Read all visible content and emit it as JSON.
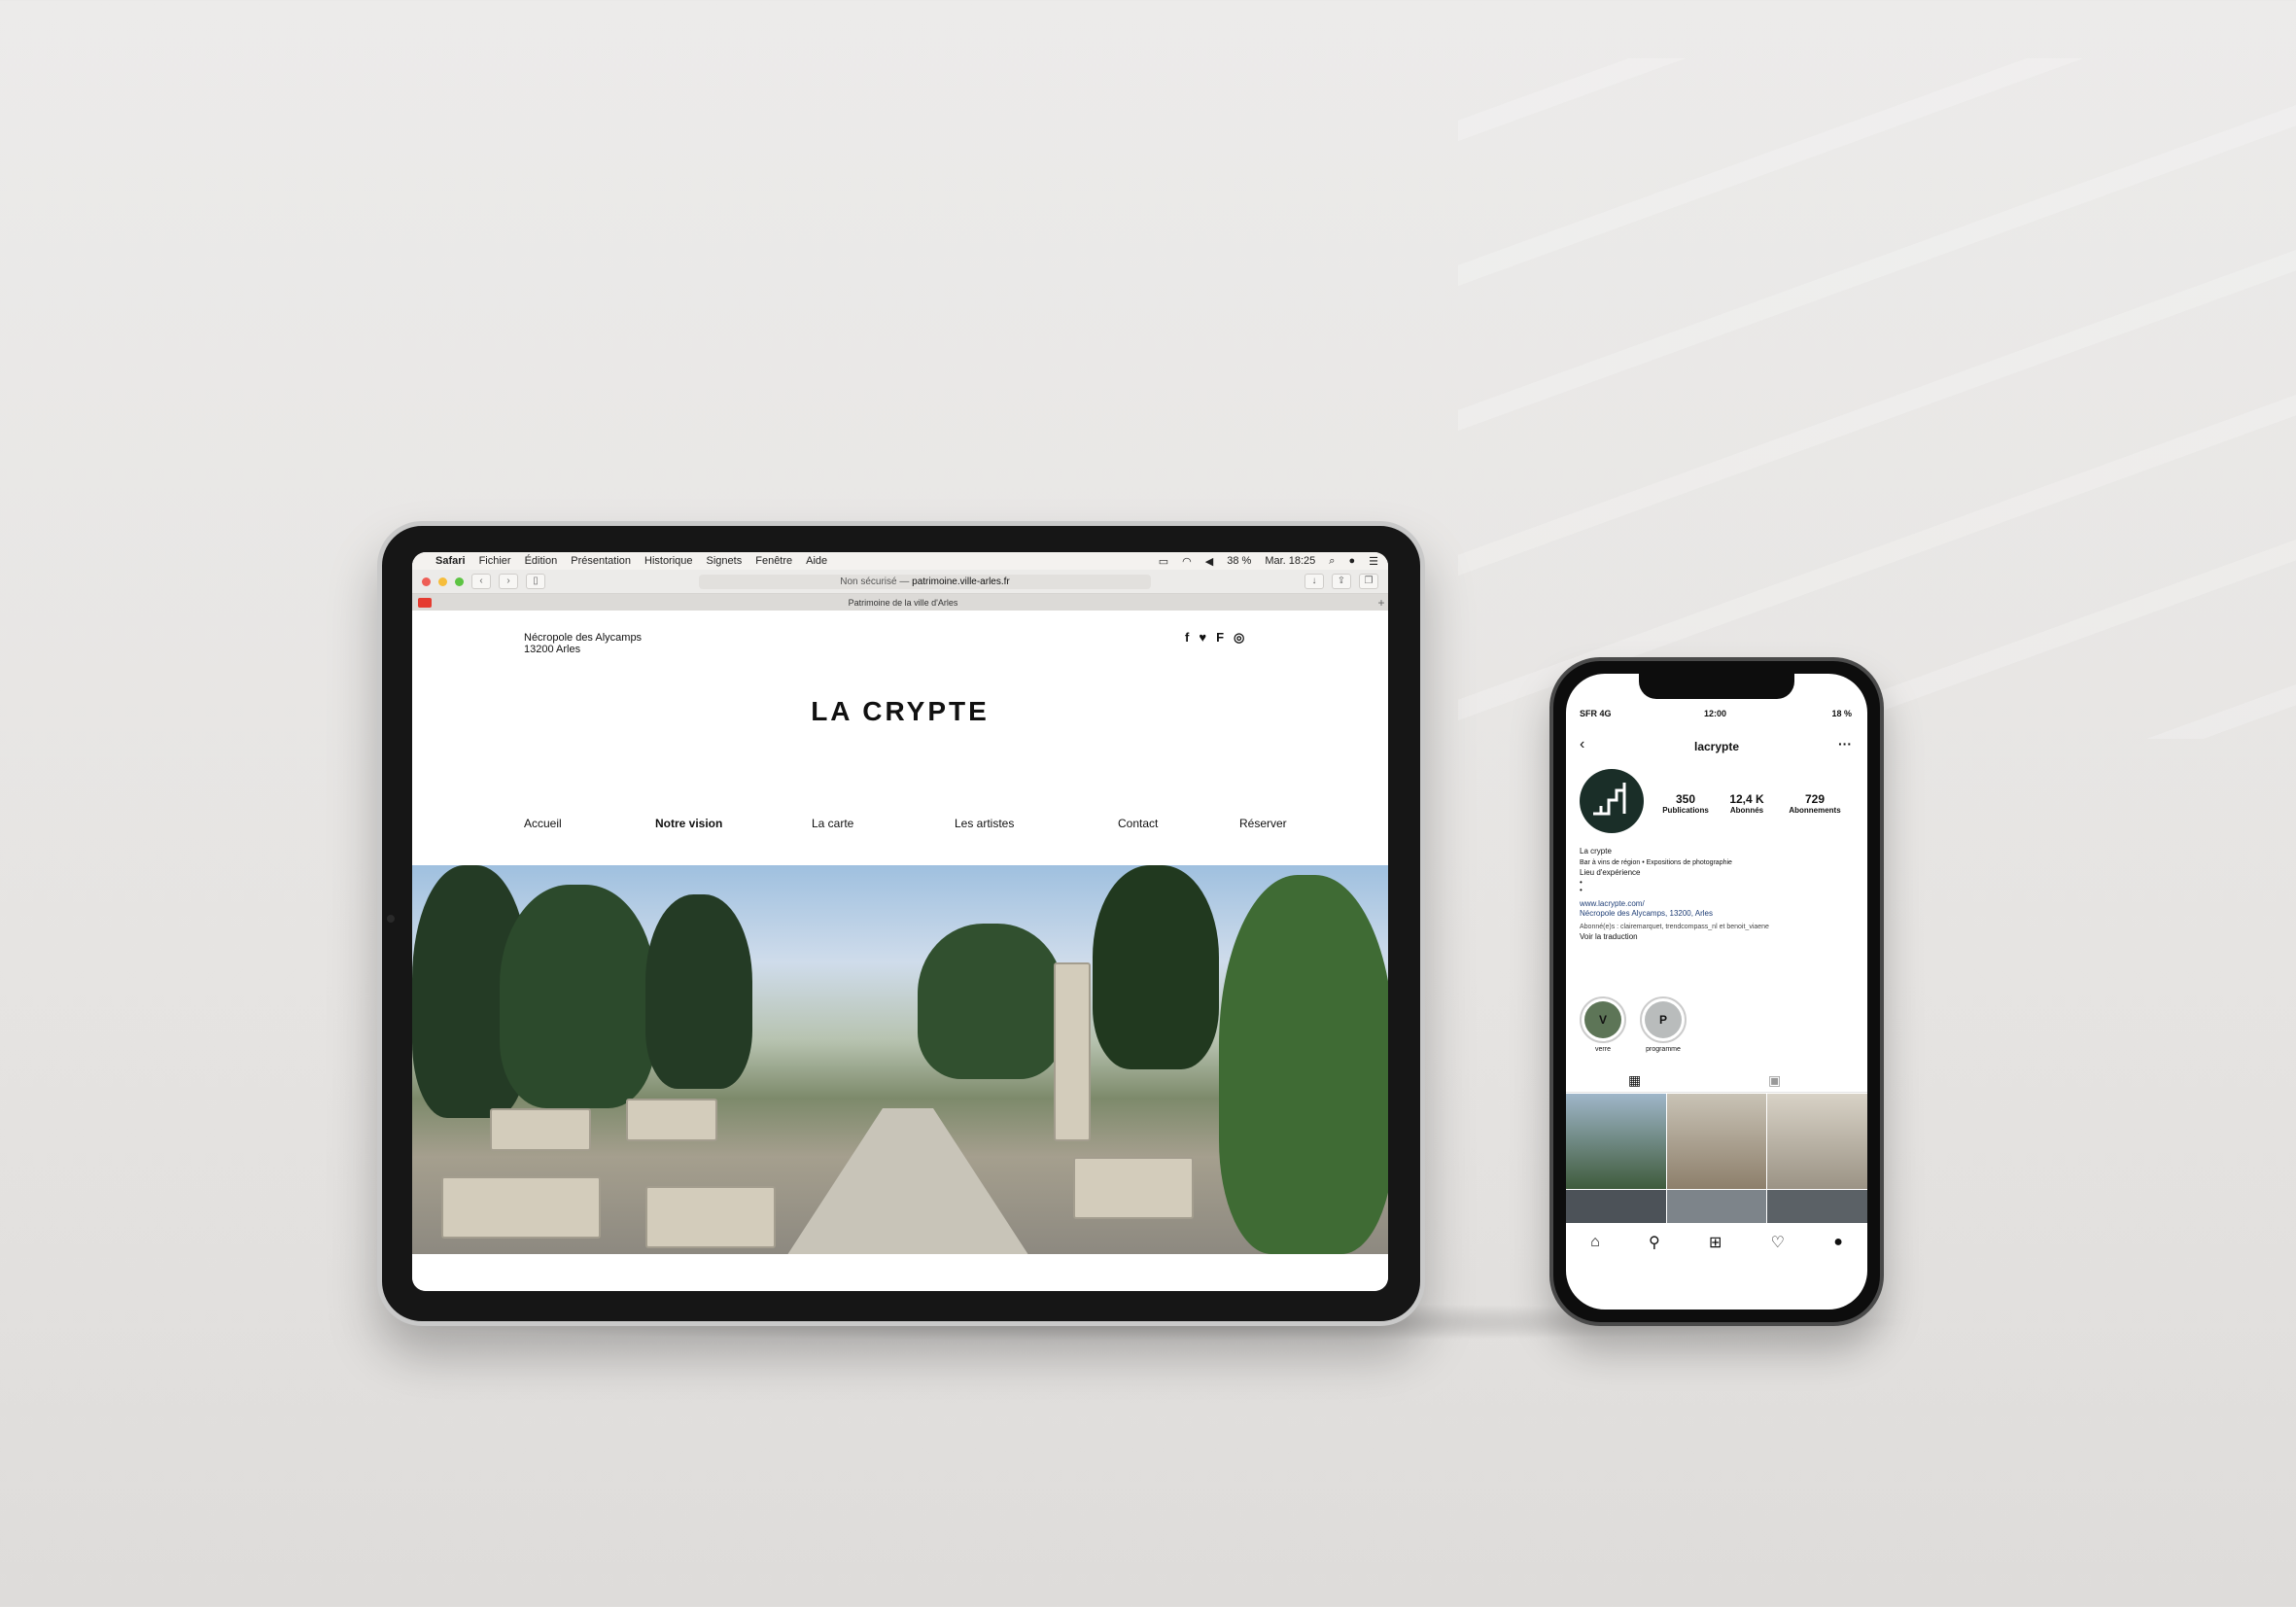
{
  "browser": {
    "menu": [
      "Safari",
      "Fichier",
      "Édition",
      "Présentation",
      "Historique",
      "Signets",
      "Fenêtre",
      "Aide"
    ],
    "battery": "38 %",
    "clock": "Mar. 18:25",
    "url_prefix": "Non sécurisé —",
    "url": "patrimoine.ville-arles.fr",
    "tab_title": "Patrimoine de la ville d'Arles"
  },
  "site": {
    "address_line1": "Nécropole des Alycamps",
    "address_line2": "13200 Arles",
    "logo": "LA CRYPTE",
    "social_icons": [
      "facebook-icon",
      "twitter-icon",
      "foursquare-icon",
      "instagram-icon"
    ],
    "nav": [
      "Accueil",
      "Notre vision",
      "La carte",
      "Les artistes",
      "Contact",
      "Réserver"
    ],
    "nav_active": "Notre vision"
  },
  "phone": {
    "carrier": "SFR 4G",
    "time": "12:00",
    "battery": "18 %",
    "username": "lacrypte",
    "stats": [
      {
        "value": "350",
        "label": "Publications"
      },
      {
        "value": "12,4 K",
        "label": "Abonnés"
      },
      {
        "value": "729",
        "label": "Abonnements"
      }
    ],
    "bio_name": "La crypte",
    "bio_desc": "Bar à vins de région • Expositions de photographie",
    "bio_sub": "Lieu d'expérience",
    "bio_bullet1": "•",
    "bio_bullet2": "•",
    "website": "www.lacrypte.com/",
    "location": "Nécropole des Alycamps, 13200, Arles",
    "followed_by": "Abonné(e)s : clairemarquet, trendcompass_nl et benoit_viaene",
    "translate": "Voir la traduction",
    "highlights": [
      {
        "letter": "V",
        "label": "verre",
        "color": "#5d7557"
      },
      {
        "letter": "P",
        "label": "programme",
        "color": "#b9bcbc"
      }
    ]
  }
}
